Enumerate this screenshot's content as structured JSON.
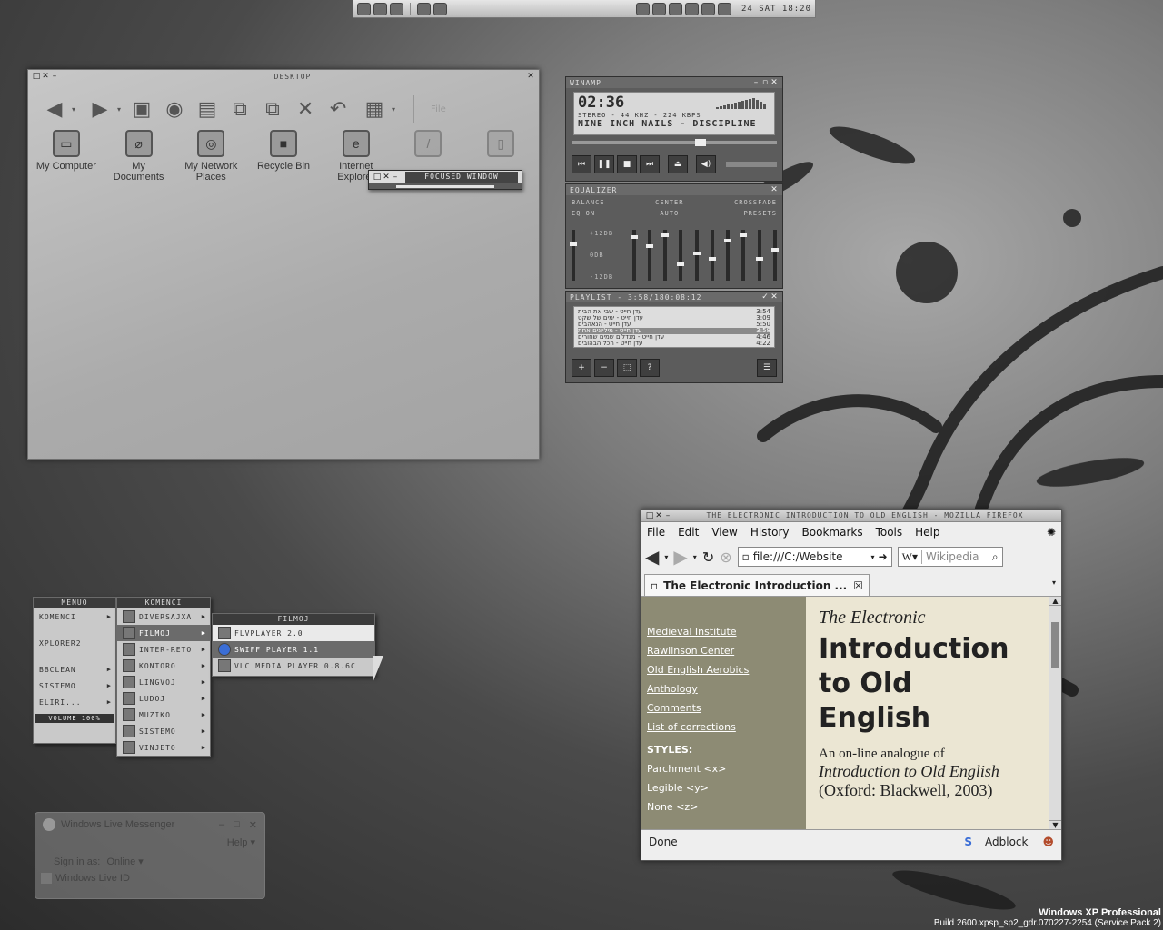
{
  "tray": {
    "clock": "24 SAT 18:20"
  },
  "explorer": {
    "title": "DESKTOP",
    "toolbar_right_label": "File",
    "icons": [
      {
        "label": "My Computer",
        "icon": "computer-icon",
        "glyph": "▭"
      },
      {
        "label": "My Documents",
        "icon": "documents-icon",
        "glyph": "⌀"
      },
      {
        "label": "My Network Places",
        "icon": "network-icon",
        "glyph": "◎"
      },
      {
        "label": "Recycle Bin",
        "icon": "recycle-bin-icon",
        "glyph": "■"
      },
      {
        "label": "Internet Explorer",
        "icon": "internet-explorer-icon",
        "glyph": "e"
      },
      {
        "label": "",
        "icon": "pencil-icon",
        "glyph": "/"
      },
      {
        "label": "",
        "icon": "file-icon",
        "glyph": "▯"
      }
    ],
    "focused_window_title": "FOCUSED WINDOW"
  },
  "winamp": {
    "title": "WINAMP",
    "time": "02:36",
    "meta": "STEREO - 44 KHZ - 224 KBPS",
    "song": "NINE INCH NAILS - DISCIPLINE",
    "seek_fraction": 0.6,
    "volume_fraction": 0.0,
    "equalizer": {
      "title": "EQUALIZER",
      "balance": "BALANCE",
      "center": "CENTER",
      "crossfade": "CROSSFADE",
      "eq_on": "EQ ON",
      "auto": "AUTO",
      "presets": "PRESETS",
      "db_top": "+12DB",
      "db_mid": "0DB",
      "db_bottom": "-12DB"
    },
    "playlist": {
      "title": "PLAYLIST - 3:58/180:08:12",
      "items": [
        {
          "name": "עדן חייט - שבי את הבית",
          "time": "3:54"
        },
        {
          "name": "עדן חייט - ימים של שקט",
          "time": "3:09"
        },
        {
          "name": "עדן חייט - הנאהבים",
          "time": "5:50"
        },
        {
          "name": "עדן חייט - מיליונים אחת",
          "time": "3:58"
        },
        {
          "name": "עדן חייט - מגדלים שמים שחורים",
          "time": "4:46"
        },
        {
          "name": "עדן חייט - הכל הבהובים",
          "time": "4:22"
        }
      ]
    }
  },
  "menu": {
    "col1": {
      "title": "MENUO",
      "items": [
        "KOMENCI",
        "XPLORER2",
        "BBCLEAN",
        "SISTEMO",
        "ELIRI..."
      ],
      "volume": "VOLUME 100%"
    },
    "col2": {
      "title": "KOMENCI",
      "items": [
        "DIVERSAJXA",
        "FILMOJ",
        "INTER-RETO",
        "KONTORO",
        "LINGVOJ",
        "LUDOJ",
        "MUZIKO",
        "SISTEMO",
        "VINJETO"
      ]
    },
    "col3": {
      "title": "FILMOJ",
      "items": [
        "FLVPLAYER 2.0",
        "SWIFF PLAYER 1.1",
        "VLC MEDIA PLAYER 0.8.6C"
      ]
    }
  },
  "messenger": {
    "title": "Windows Live Messenger",
    "help": "Help",
    "sign_in_as": "Sign in as:",
    "status": "Online",
    "id_label": "Windows Live ID"
  },
  "firefox": {
    "title": "THE ELECTRONIC INTRODUCTION TO OLD ENGLISH - MOZILLA FIREFOX",
    "menu": [
      "File",
      "Edit",
      "View",
      "History",
      "Bookmarks",
      "Tools",
      "Help"
    ],
    "url": "file:///C:/Website",
    "search_placeholder": "Wikipedia",
    "tab_label": "The Electronic Introduction ...",
    "sidebar_links": [
      "Medieval Institute",
      "Rawlinson Center",
      "Old English Aerobics",
      "Anthology",
      "Comments",
      "List of corrections"
    ],
    "styles_heading": "STYLES:",
    "styles": [
      "Parchment <x>",
      "Legible <y>",
      "None <z>"
    ],
    "page": {
      "kicker": "The Electronic",
      "title_line1": "Introduction",
      "title_line2": "to Old",
      "title_line3": "English",
      "lead": "An on-line analogue of",
      "book": "Introduction to Old English",
      "pub": "(Oxford: Blackwell, 2003)"
    },
    "status": "Done",
    "adblock": "Adblock"
  },
  "watermark": {
    "line1": "Windows XP Professional",
    "line2": "Build 2600.xpsp_sp2_gdr.070227-2254 (Service Pack 2)"
  }
}
